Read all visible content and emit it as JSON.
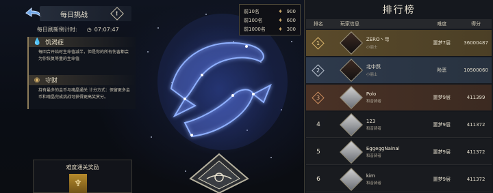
{
  "header": {
    "title": "每日挑战",
    "info_icon_glyph": "!"
  },
  "timer": {
    "label": "每日刷新倒计时:",
    "value": "07:07:47"
  },
  "effects": [
    {
      "name": "饥渴症",
      "icon": "water-drop-icon",
      "desc": "每回合开始时生命值减半，但是你的所有伤害都会为你恢复等量的生命值"
    },
    {
      "name": "守财",
      "icon": "coin-icon",
      "desc": "持有最多的金币与魂晶通关 计分方式：保留更多金币和魂晶完成挑战可获得更高奖赏分。"
    }
  ],
  "tiers": [
    {
      "label": "前10名",
      "value": "900"
    },
    {
      "label": "前100名",
      "value": "600"
    },
    {
      "label": "前1000名",
      "value": "300"
    }
  ],
  "reward": {
    "title": "难度通关奖励"
  },
  "ranking": {
    "title": "排行榜",
    "columns": {
      "rank": "排名",
      "player": "玩家信息",
      "difficulty": "难度",
      "score": "得分"
    },
    "rows": [
      {
        "rank": "1",
        "name": "ZERO丶穹",
        "title": "小丽士",
        "difficulty": "噩梦7层",
        "score": "36000487",
        "style": "gold"
      },
      {
        "rank": "2",
        "name": "北中然",
        "title": "小丽士",
        "difficulty": "险恶",
        "score": "10500060",
        "style": "silver"
      },
      {
        "rank": "3",
        "name": "Polo",
        "title": "和音骑者",
        "difficulty": "噩梦9层",
        "score": "411399",
        "style": "bronze"
      },
      {
        "rank": "4",
        "name": "123",
        "title": "和音骑者",
        "difficulty": "噩梦9层",
        "score": "411372",
        "style": "plain"
      },
      {
        "rank": "5",
        "name": "EggeggNainai",
        "title": "和音骑者",
        "difficulty": "噩梦9层",
        "score": "411372",
        "style": "plain"
      },
      {
        "rank": "6",
        "name": "kim",
        "title": "和音骑者",
        "difficulty": "噩梦9层",
        "score": "411372",
        "style": "plain"
      }
    ]
  },
  "colors": {
    "gold": "#d8b36a",
    "constellation": "#6f8cff"
  }
}
